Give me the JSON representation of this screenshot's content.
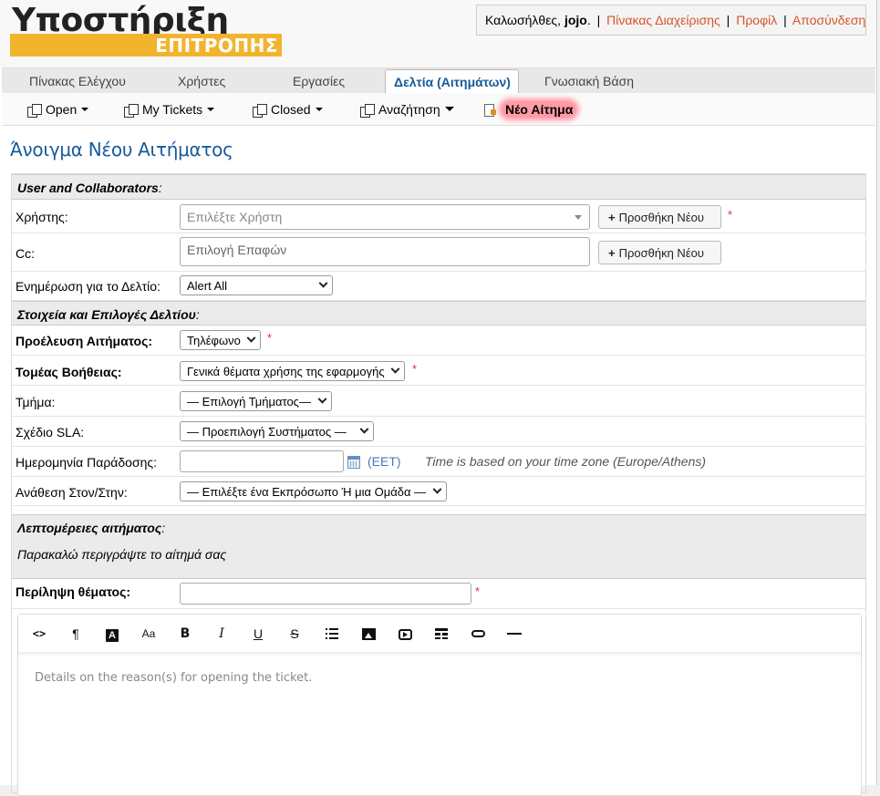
{
  "header": {
    "logo_title": "Υποστήριξη",
    "logo_subtitle": "ΕΠΙΤΡΟΠΗΣ",
    "welcome_prefix": "Καλωσήλθες, ",
    "username": "jojo",
    "welcome_suffix": ".",
    "links": {
      "admin_panel": "Πίνακας Διαχείρισης",
      "profile": "Προφίλ",
      "logout": "Αποσύνδεση"
    },
    "separator": "|"
  },
  "tabs": [
    {
      "label": "Πίνακας Ελέγχου"
    },
    {
      "label": "Χρήστες"
    },
    {
      "label": "Εργασίες"
    },
    {
      "label": "Δελτία (Αιτημάτων)",
      "active": true
    },
    {
      "label": "Γνωσιακή Βάση"
    }
  ],
  "subnav": [
    {
      "label": "Open"
    },
    {
      "label": "My Tickets"
    },
    {
      "label": "Closed"
    },
    {
      "label": "Αναζήτηση"
    },
    {
      "label": "Νέο Αίτημα"
    }
  ],
  "page_title": "Άνοιγμα Νέου Αιτήματος",
  "sections": {
    "user_collab": "User and Collaborators",
    "ticket_info": "Στοιχεία και Επιλογές Δελτίου",
    "ticket_details": "Λεπτομέρειες αιτήματος",
    "details_instruction": "Παρακαλώ περιγράψτε το αίτημά σας",
    "colon": ":"
  },
  "fields": {
    "user": {
      "label": "Χρήστης:",
      "placeholder": "Επιλέξτε Χρήστη",
      "add_button": "Προσθήκη Νέου"
    },
    "cc": {
      "label": "Cc:",
      "placeholder": "Επιλογή Επαφών",
      "add_button": "Προσθήκη Νέου"
    },
    "alert": {
      "label": "Ενημέρωση για το Δελτίο:",
      "value": "Alert All"
    },
    "source": {
      "label": "Προέλευση Αιτήματος:",
      "value": "Τηλέφωνο"
    },
    "help_topic": {
      "label": "Τομέας Βοήθειας:",
      "value": "Γενικά θέματα χρήσης της εφαρμογής"
    },
    "department": {
      "label": "Τμήμα:",
      "value": "— Επιλογή Τμήματος—"
    },
    "sla": {
      "label": "Σχέδιο SLA:",
      "value": "— Προεπιλογή Συστήματος —"
    },
    "due_date": {
      "label": "Ημερομηνία Παράδοσης:",
      "value": "",
      "timezone": "(EET)",
      "tz_note": "Time is based on your time zone (Europe/Athens)"
    },
    "assign": {
      "label": "Ανάθεση Στον/Στην:",
      "value": "— Επιλέξτε ένα Εκπρόσωπο Ή μια Ομάδα —"
    },
    "summary": {
      "label": "Περίληψη θέματος:",
      "value": ""
    },
    "required_mark": "*",
    "plus": "+"
  },
  "editor": {
    "placeholder": "Details on the reason(s) for opening the ticket.",
    "toolbar": [
      {
        "icon": "code-icon",
        "glyph": "<>"
      },
      {
        "icon": "paragraph-icon",
        "glyph": "¶"
      },
      {
        "icon": "font-color-icon",
        "glyph": "A"
      },
      {
        "icon": "font-size-icon",
        "glyph": "Aa"
      },
      {
        "icon": "bold-icon",
        "glyph": "B"
      },
      {
        "icon": "italic-icon",
        "glyph": "I"
      },
      {
        "icon": "underline-icon",
        "glyph": "U"
      },
      {
        "icon": "strikethrough-icon",
        "glyph": "S"
      },
      {
        "icon": "list-icon"
      },
      {
        "icon": "image-icon"
      },
      {
        "icon": "video-icon"
      },
      {
        "icon": "table-icon"
      },
      {
        "icon": "link-icon"
      },
      {
        "icon": "horizontal-rule-icon"
      }
    ]
  },
  "colors": {
    "accent_blue": "#175a9a",
    "link_orange": "#d8532b",
    "logo_yellow": "#f2b32d",
    "highlight_pink": "#ff9aa6",
    "required_red": "#dd3333"
  }
}
